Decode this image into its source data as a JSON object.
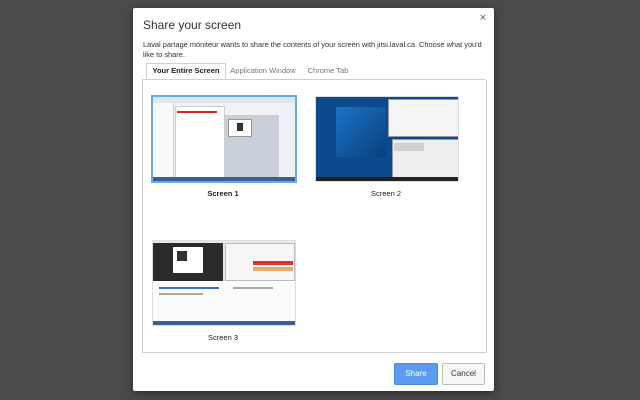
{
  "dialog": {
    "title": "Share your screen",
    "close_glyph": "×",
    "description": "Laval partage moniteur wants to share the contents of your screen with jitsi.laval.ca. Choose what you'd like to share.",
    "tabs": [
      {
        "label": "Your Entire Screen",
        "active": true
      },
      {
        "label": "Application Window",
        "active": false
      },
      {
        "label": "Chrome Tab",
        "active": false
      }
    ],
    "screens": [
      {
        "label": "Screen 1",
        "selected": true
      },
      {
        "label": "Screen 2",
        "selected": false
      },
      {
        "label": "Screen 3",
        "selected": false
      }
    ],
    "buttons": {
      "share": "Share",
      "cancel": "Cancel"
    }
  },
  "colors": {
    "backdrop": "#4a4a4a",
    "accent": "#5b9cf2",
    "selection_border": "#6aa9e8",
    "desktop_blue": "#0b4a8c"
  },
  "icons": [
    "close-icon"
  ]
}
